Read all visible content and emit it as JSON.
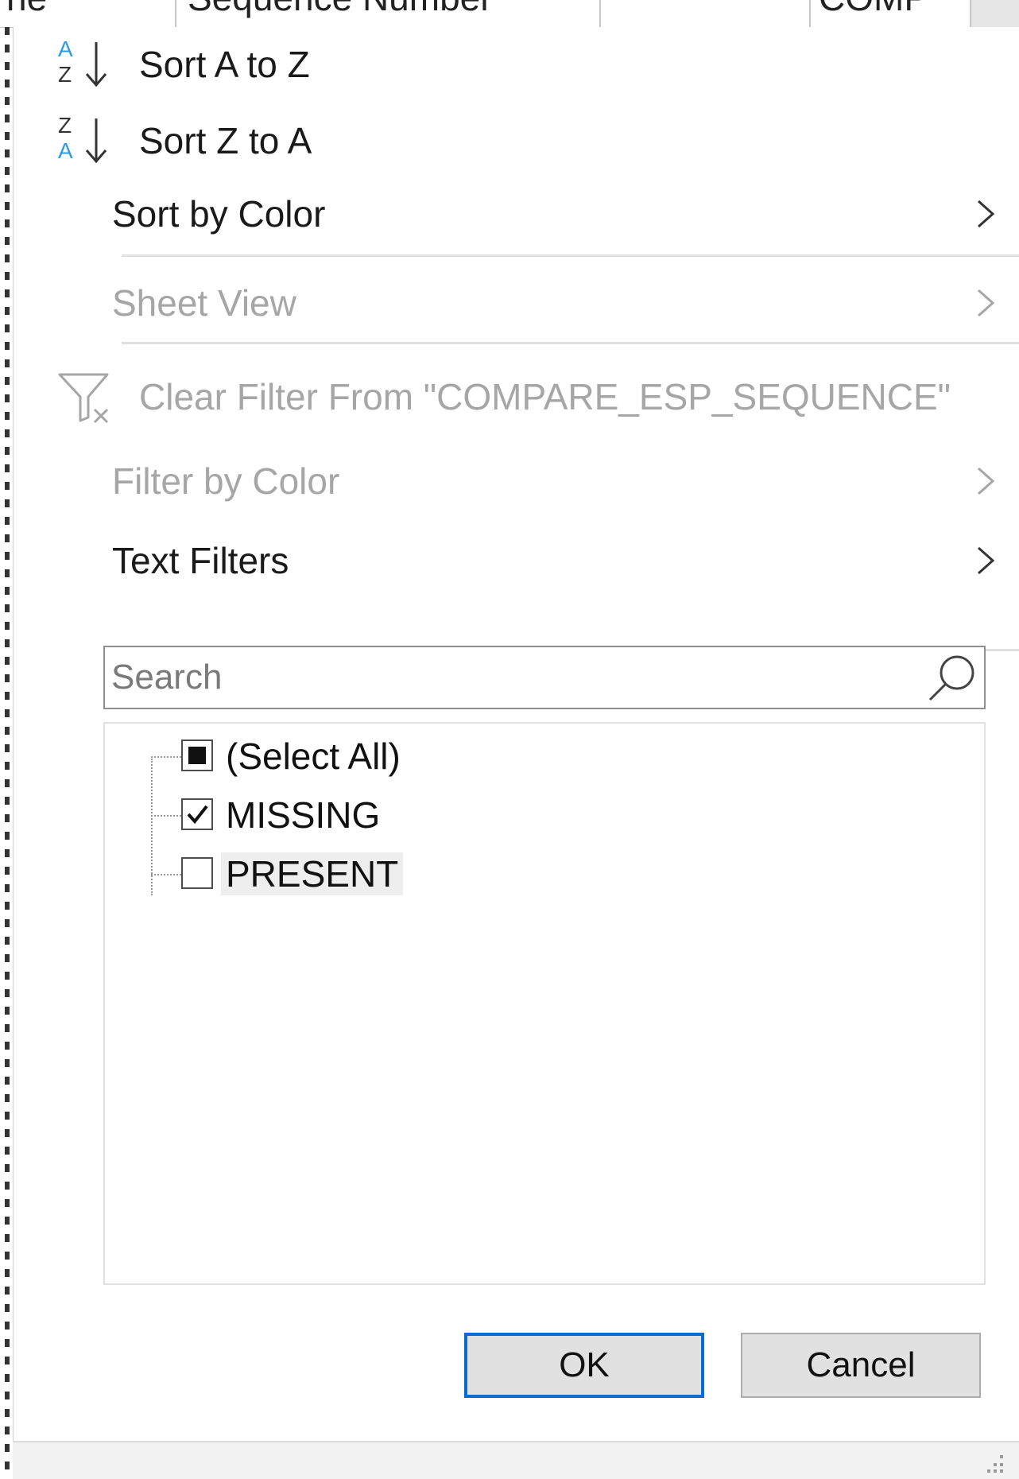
{
  "sheet_header": {
    "col_left_text": "ne",
    "col_mid_text": "Sequence Number",
    "col_right_text": "COMP"
  },
  "menu": {
    "sort_asc_label": "Sort A to Z",
    "sort_desc_label": "Sort Z to A",
    "sort_by_color_label": "Sort by Color",
    "sheet_view_label": "Sheet View",
    "clear_filter_label": "Clear Filter From \"COMPARE_ESP_SEQUENCE\"",
    "filter_by_color_label": "Filter by Color",
    "text_filters_label": "Text Filters"
  },
  "search": {
    "placeholder": "Search",
    "value": ""
  },
  "list": {
    "items": [
      {
        "label": "(Select All)",
        "state": "mixed"
      },
      {
        "label": "MISSING",
        "state": "checked"
      },
      {
        "label": "PRESENT",
        "state": "unchecked"
      }
    ]
  },
  "buttons": {
    "ok_label": "OK",
    "cancel_label": "Cancel"
  },
  "colors": {
    "accent_blue": "#0a6cd0",
    "sort_icon_blue": "#2e9be0",
    "disabled_text": "#a6a6a6"
  },
  "icons": {
    "sort_asc": "sort-a-to-z-icon",
    "sort_desc": "sort-z-to-a-icon",
    "clear_filter": "clear-filter-icon",
    "search": "search-icon",
    "submenu": "chevron-right-icon"
  }
}
